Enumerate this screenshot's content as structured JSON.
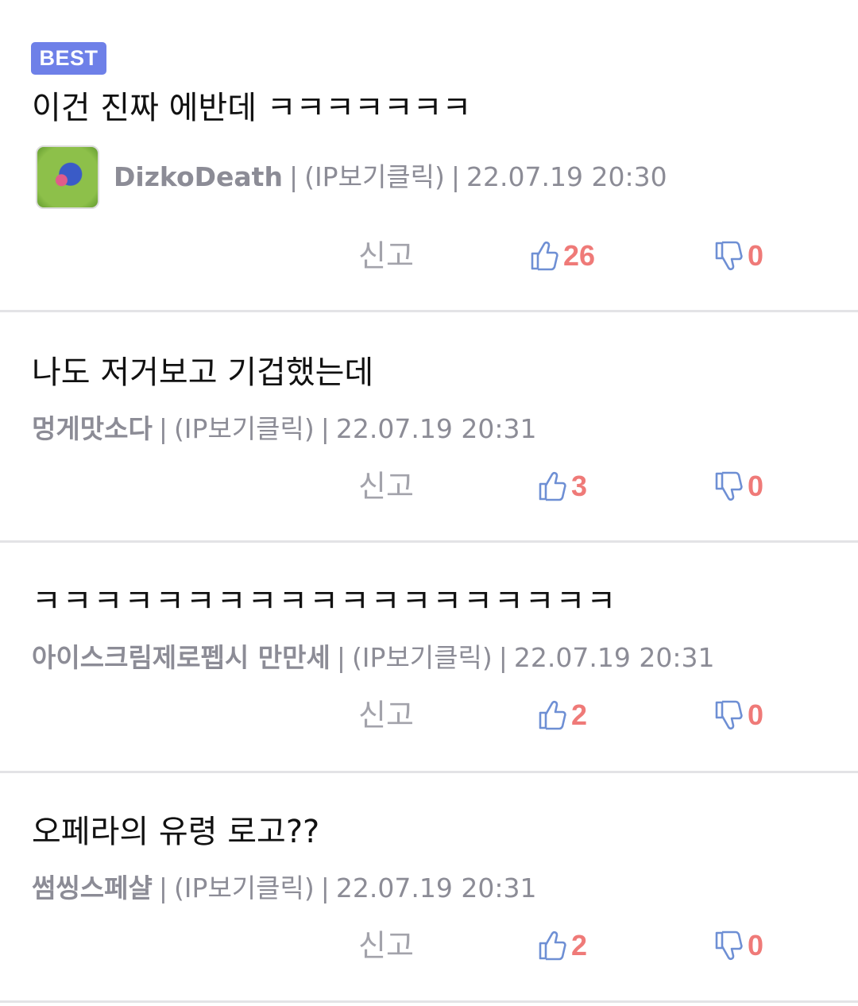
{
  "colors": {
    "badge": "#6e80e8",
    "count": "#ef7a78",
    "meta": "#8c8c96",
    "icon": "#6e8fd4"
  },
  "comments": [
    {
      "badge": "BEST",
      "text": "이건 진짜 에반데 ㅋㅋㅋㅋㅋㅋㅋ",
      "author": "DizkoDeath",
      "ip": "(IP보기클릭)",
      "date": "22.07.19 20:30",
      "report": "신고",
      "likes": "26",
      "dislikes": "0"
    },
    {
      "text": "나도 저거보고 기겁했는데",
      "author": "멍게맛소다",
      "ip": "(IP보기클릭)",
      "date": "22.07.19 20:31",
      "report": "신고",
      "likes": "3",
      "dislikes": "0"
    },
    {
      "text": "ㅋㅋㅋㅋㅋㅋㅋㅋㅋㅋㅋㅋㅋㅋㅋㅋㅋㅋㅋ",
      "author": "아이스크림제로펩시 만만세",
      "ip": "(IP보기클릭)",
      "date": "22.07.19 20:31",
      "report": "신고",
      "likes": "2",
      "dislikes": "0"
    },
    {
      "text": "오페라의 유령 로고??",
      "author": "썸씽스페샬",
      "ip": "(IP보기클릭)",
      "date": "22.07.19 20:31",
      "report": "신고",
      "likes": "2",
      "dislikes": "0"
    }
  ]
}
